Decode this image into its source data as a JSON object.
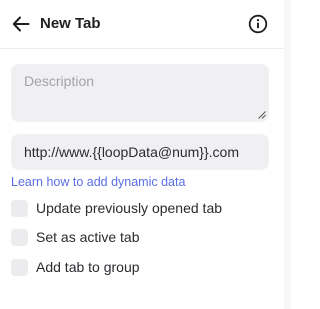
{
  "header": {
    "title": "New Tab",
    "back_icon": "arrow-left-icon",
    "info_icon": "info-circle-icon"
  },
  "form": {
    "description_placeholder": "Description",
    "url_value": "http://www.{{loopData@num}}.com",
    "help_link": "Learn how to add dynamic data",
    "options": [
      {
        "label": "Update previously opened tab",
        "checked": false
      },
      {
        "label": "Set as active tab",
        "checked": false
      },
      {
        "label": "Add tab to group",
        "checked": false
      }
    ]
  },
  "colors": {
    "link": "#5b6ee8",
    "field_background": "#f0f0f2",
    "text": "#2b2b30"
  }
}
